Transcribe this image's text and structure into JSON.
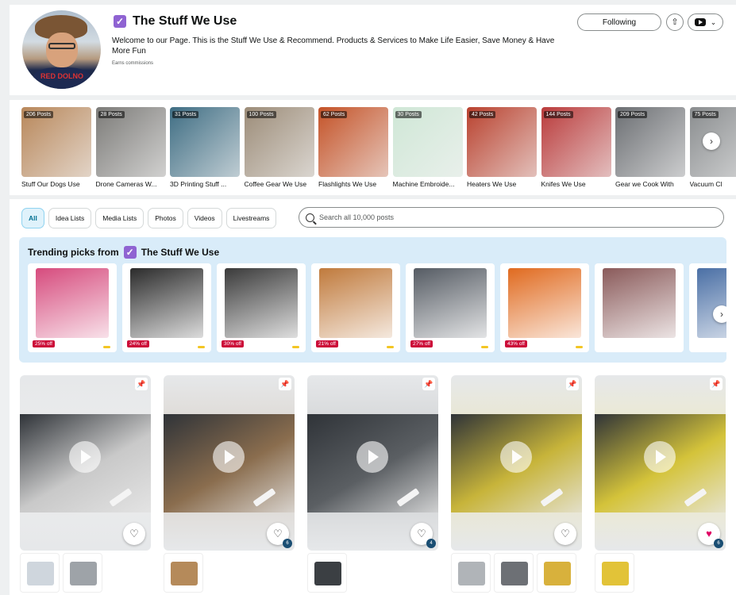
{
  "profile": {
    "name": "The Stuff We Use",
    "avatar_shirt_text": "RED DOLNO",
    "description": "Welcome to our Page. This is the Stuff We Use & Recommend. Products & Services to Make Life Easier, Save Money & Have More Fun",
    "commissions": "Earns commissions",
    "follow_label": "Following",
    "share_icon": "share-icon",
    "social_icon": "youtube-icon"
  },
  "categories": [
    {
      "label": "Stuff Our Dogs Use",
      "posts": "206 Posts",
      "color": "#b8875a"
    },
    {
      "label": "Drone Cameras W...",
      "posts": "28 Posts",
      "color": "#7c7b78"
    },
    {
      "label": "3D Printing Stuff ...",
      "posts": "31 Posts",
      "color": "#3e6d83"
    },
    {
      "label": "Coffee Gear We Use",
      "posts": "100 Posts",
      "color": "#9c8c78"
    },
    {
      "label": "Flashlights We Use",
      "posts": "62 Posts",
      "color": "#c45227"
    },
    {
      "label": "Machine Embroide...",
      "posts": "30 Posts",
      "color": "#cfe7d6"
    },
    {
      "label": "Heaters We Use",
      "posts": "42 Posts",
      "color": "#b9412e"
    },
    {
      "label": "Knifes We Use",
      "posts": "144 Posts",
      "color": "#ba3b3b"
    },
    {
      "label": "Gear we Cook With",
      "posts": "209 Posts",
      "color": "#6b6e72"
    },
    {
      "label": "Vacuum Cl",
      "posts": "75 Posts",
      "color": "#8a8d8f"
    }
  ],
  "filters": [
    "All",
    "Idea Lists",
    "Media Lists",
    "Photos",
    "Videos",
    "Livestreams"
  ],
  "active_filter": "All",
  "search": {
    "placeholder": "Search all 10,000 posts"
  },
  "trending": {
    "title": "Trending picks from",
    "store": "The Stuff We Use",
    "products": [
      {
        "discount": "25% off",
        "color": "#d64b7d"
      },
      {
        "discount": "24% off",
        "color": "#2b2b2b"
      },
      {
        "discount": "30% off",
        "color": "#3a3a3a"
      },
      {
        "discount": "21% off",
        "color": "#c07a3c"
      },
      {
        "discount": "27% off",
        "color": "#555b63"
      },
      {
        "discount": "43% off",
        "color": "#e06a1f"
      },
      {
        "discount": "",
        "color": "#8a5a5a"
      },
      {
        "discount": "",
        "color": "#4a6fa5"
      }
    ]
  },
  "posts": [
    {
      "color": "#c9c9c9",
      "liked": false,
      "count": "",
      "thumbs": [
        "#cfd6dd",
        "#9ea3a8"
      ]
    },
    {
      "color": "#8a6d4e",
      "liked": false,
      "count": "6",
      "thumbs": [
        "#b58a5a"
      ]
    },
    {
      "color": "#5b5f63",
      "liked": false,
      "count": "4",
      "thumbs": [
        "#3b3f43"
      ]
    },
    {
      "color": "#c7b43a",
      "liked": false,
      "count": "",
      "thumbs": [
        "#b0b4b8",
        "#6d7075",
        "#d8b13c"
      ]
    },
    {
      "color": "#d4c33a",
      "liked": true,
      "count": "6",
      "thumbs": [
        "#e2c338"
      ]
    }
  ],
  "icons": {
    "verified": "verified-check-icon",
    "next": "chevron-right-icon",
    "pin": "pin-icon",
    "play": "play-icon",
    "heart": "heart-icon",
    "search": "search-icon"
  }
}
